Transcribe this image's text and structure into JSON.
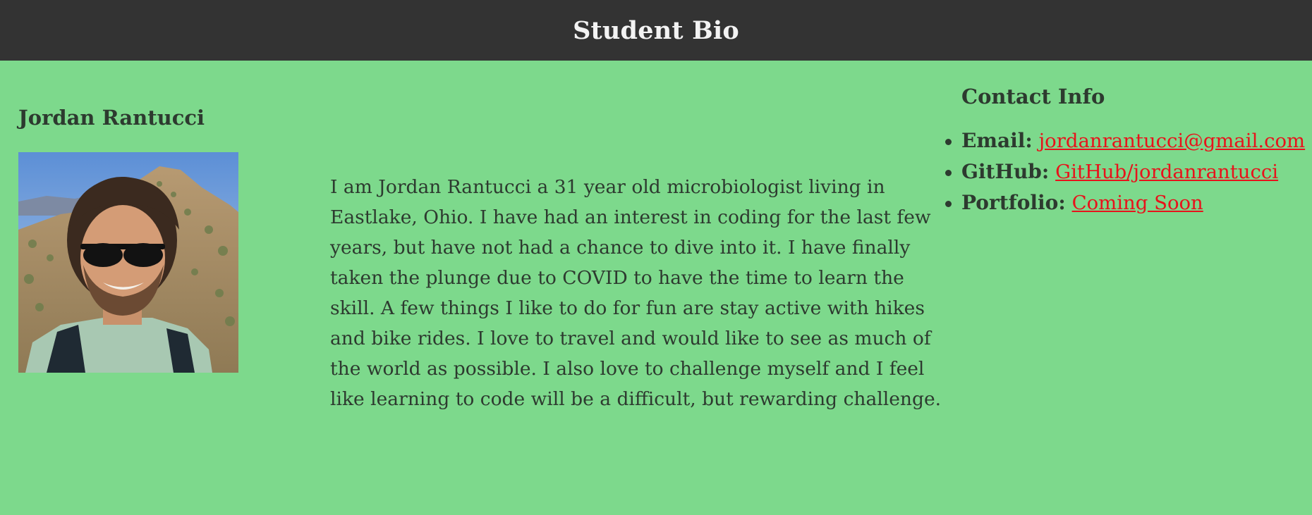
{
  "header": {
    "title": "Student Bio"
  },
  "profile": {
    "name": "Jordan Rantucci",
    "photo_icon": "portrait-photo",
    "bio": "I am Jordan Rantucci a 31 year old microbiologist living in Eastlake, Ohio. I have had an interest in coding for the last few years, but have not had a chance to dive into it. I have finally taken the plunge due to COVID to have the time to learn the skill. A few things I like to do for fun are stay active with hikes and bike rides. I love to travel and would like to see as much of the world as possible. I also love to challenge myself and I feel like learning to code will be a difficult, but rewarding challenge."
  },
  "contact": {
    "title": "Contact Info",
    "items": [
      {
        "label": "Email:",
        "link_text": "jordanrantucci@gmail.com"
      },
      {
        "label": "GitHub:",
        "link_text": "GitHub/jordanrantucci"
      },
      {
        "label": "Portfolio:",
        "link_text": "Coming Soon"
      }
    ]
  },
  "colors": {
    "background": "#7dd98c",
    "header_background": "#333333",
    "header_text": "#f3f3f3",
    "body_text": "#2d3a2f",
    "link": "#e8121b"
  }
}
